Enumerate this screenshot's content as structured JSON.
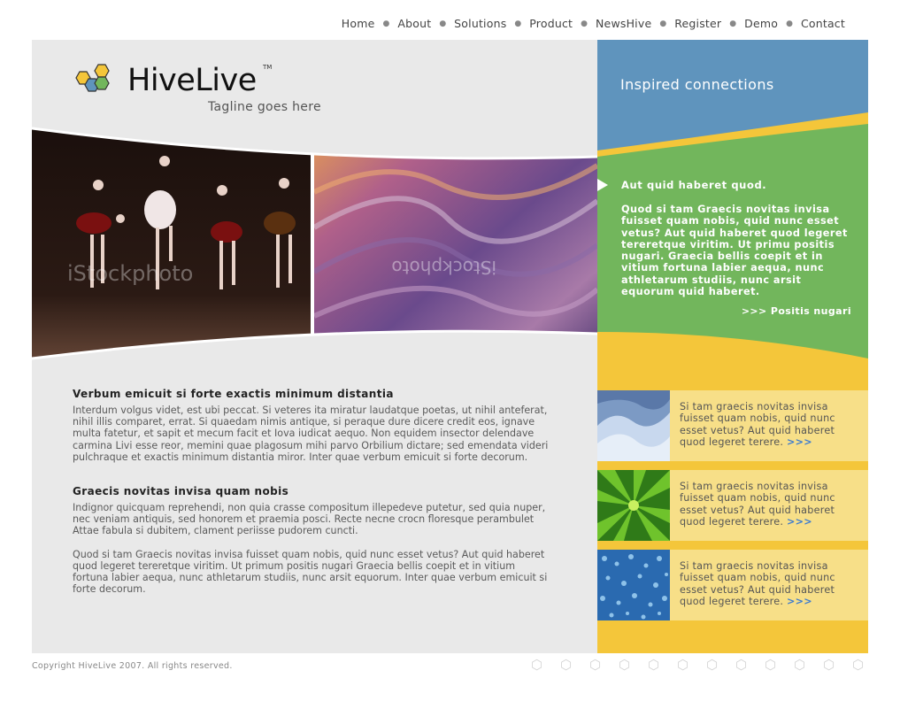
{
  "nav": [
    "Home",
    "About",
    "Solutions",
    "Product",
    "NewsHive",
    "Register",
    "Demo",
    "Contact"
  ],
  "logo": {
    "part1": "Hive",
    "part2": "Live",
    "tm": "TM"
  },
  "tagline": "Tagline goes here",
  "photos": {
    "watermark1": "iStockphoto",
    "watermark2": "iStockphoto"
  },
  "sections": [
    {
      "heading": "Verbum emicuit si forte exactis minimum distantia",
      "paragraphs": [
        "Interdum volgus videt, est ubi peccat. Si veteres ita miratur laudatque poetas, ut nihil anteferat, nihil illis comparet, errat. Si quaedam nimis antique, si peraque dure dicere credit eos, ignave multa fatetur, et sapit et mecum facit et Iova iudicat aequo. Non equidem insector delendave carmina Livi esse reor, memini quae plagosum mihi parvo Orbilium dictare; sed emendata videri pulchraque et exactis minimum distantia miror. Inter quae verbum emicuit si forte decorum."
      ]
    },
    {
      "heading": "Graecis novitas invisa quam nobis",
      "paragraphs": [
        "Indignor quicquam reprehendi, non quia crasse compositum illepedeve putetur, sed quia nuper, nec veniam antiquis, sed honorem et praemia posci. Recte necne crocn floresque perambulet Attae fabula si dubitem, clament periisse pudorem cuncti.",
        "Quod si tam Graecis novitas invisa fuisset quam nobis, quid nunc esset vetus? Aut quid haberet quod legeret tereretque viritim. Ut primum positis nugari Graecia bellis coepit et in vitium fortuna labier aequa, nunc athletarum studiis, nunc arsit equorum. Inter quae verbum emicuit si forte decorum."
      ]
    }
  ],
  "right": {
    "inspired": "Inspired connections",
    "green_heading": "Aut quid haberet quod.",
    "green_body": "Quod si tam Graecis novitas invisa fuisset quam nobis, quid nunc esset vetus? Aut quid haberet quod legeret tereretque viritim. Ut primu positis nugari. Graecia bellis coepit et in vitium fortuna labier aequa, nunc athletarum studiis, nunc arsit equorum quid haberet.",
    "green_more": ">>> Positis nugari",
    "features": [
      {
        "text": "Si tam graecis novitas invisa fuisset quam nobis, quid nunc esset vetus? Aut quid haberet quod legeret terere.",
        "more": ">>>",
        "thumb": "snow-dunes"
      },
      {
        "text": "Si tam graecis novitas invisa fuisset quam nobis, quid nunc esset vetus? Aut quid haberet quod legeret terere.",
        "more": ">>>",
        "thumb": "green-leaf"
      },
      {
        "text": "Si tam graecis novitas invisa fuisset quam nobis, quid nunc esset vetus? Aut quid haberet quod legeret terere.",
        "more": ">>>",
        "thumb": "water-droplets"
      }
    ]
  },
  "footer": {
    "copyright": "Copyright HiveLive 2007. All rights reserved."
  },
  "colors": {
    "blue": "#5f94bd",
    "green": "#72b65c",
    "yellow": "#f4c63a",
    "pale_yellow": "#f7df88",
    "panel": "#e9e9e9",
    "link": "#3a7ad0"
  }
}
